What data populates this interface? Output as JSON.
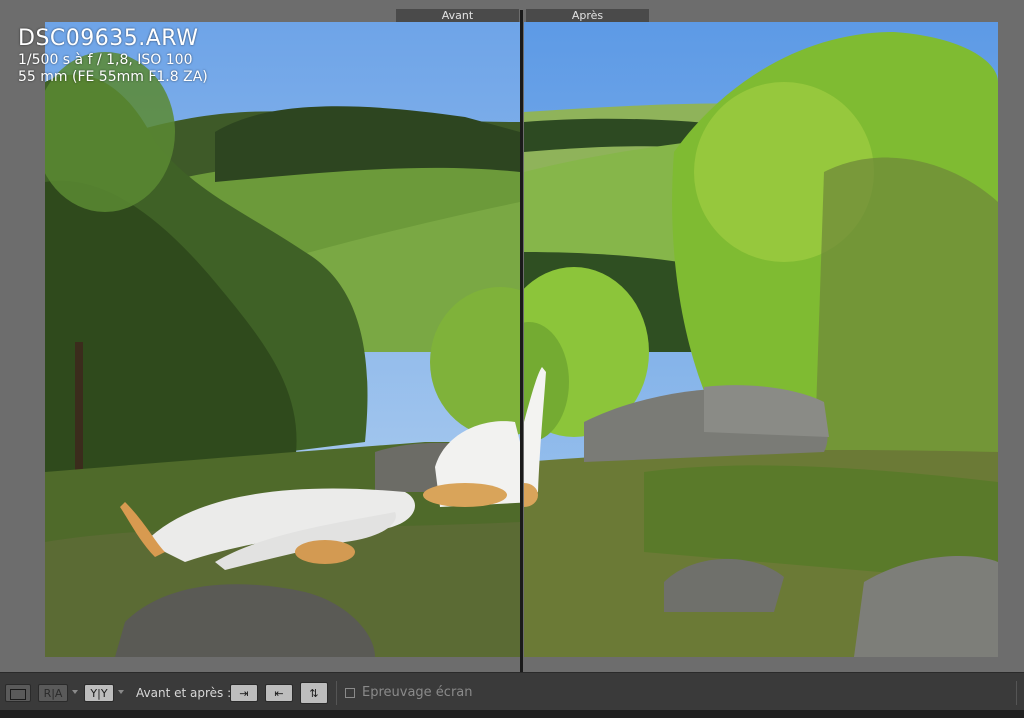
{
  "view": {
    "before_label": "Avant",
    "after_label": "Après"
  },
  "photo_info": {
    "filename": "DSC09635.ARW",
    "exposure": "1/500 s à f / 1,8, ISO 100",
    "lens": "55 mm (FE 55mm F1.8 ZA)"
  },
  "toolbar": {
    "loupe_icon": "single-view-icon",
    "ra_label": "R|A",
    "yy_label": "Y|Y",
    "before_after_label": "Avant et après :",
    "copy_before_to_after_icon": "arrow-right-icon",
    "copy_after_to_before_icon": "arrow-left-icon",
    "swap_icon": "swap-icon",
    "softproof_label": "Epreuvage écran"
  },
  "colors": {
    "toolbar_bg": "#3a3a3a",
    "view_bg": "#6d6d6d",
    "label_bg": "#4a4a4a"
  }
}
